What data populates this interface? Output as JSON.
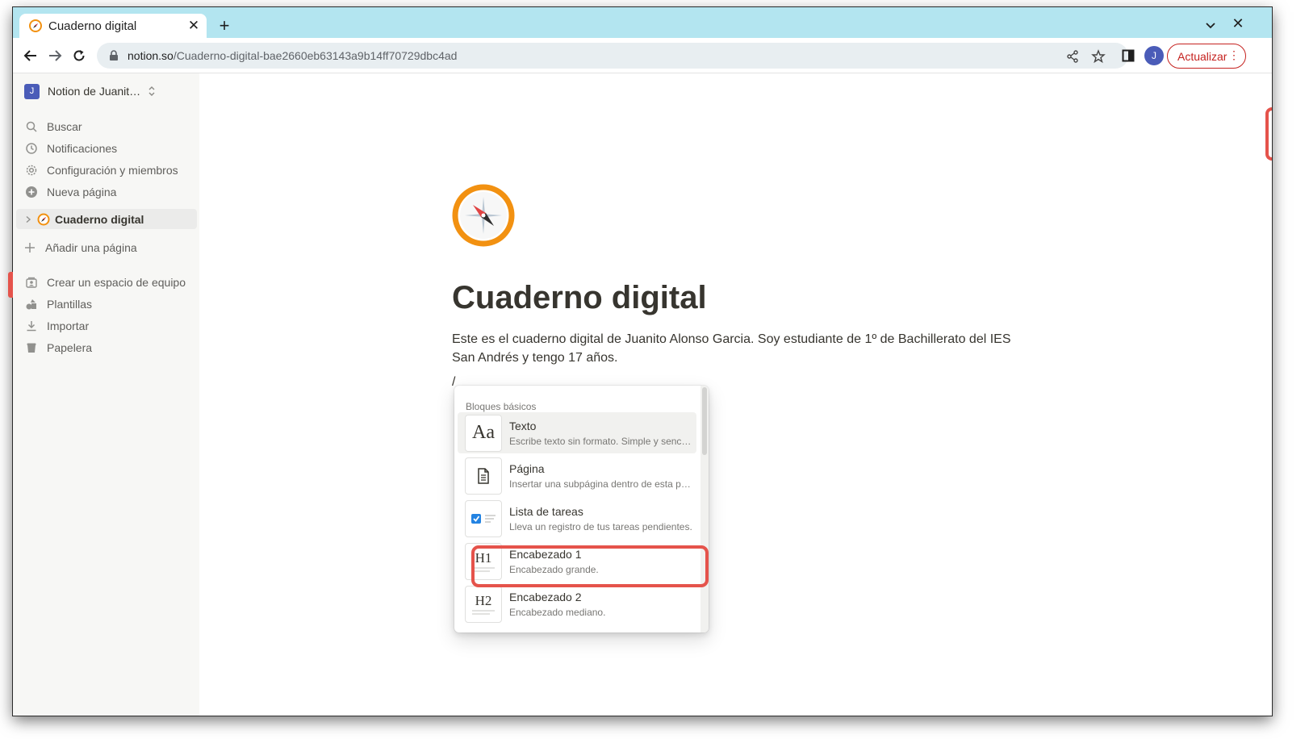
{
  "browser": {
    "tab_title": "Cuaderno digital",
    "url_domain": "notion.so",
    "url_path": "/Cuaderno-digital-bae2660eb63143a9b14ff70729dbc4ad",
    "profile_initial": "J",
    "update_label": "Actualizar"
  },
  "sidebar": {
    "workspace_initial": "J",
    "workspace_name": "Notion de Juanit…",
    "top_items": [
      {
        "label": "Buscar",
        "icon": "search-icon"
      },
      {
        "label": "Notificaciones",
        "icon": "clock-icon"
      },
      {
        "label": "Configuración y miembros",
        "icon": "gear-icon"
      },
      {
        "label": "Nueva página",
        "icon": "plus-circle-icon"
      }
    ],
    "page": "Cuaderno digital",
    "add_page": "Añadir una página",
    "bottom_items": [
      {
        "label": "Crear un espacio de equipo",
        "icon": "teamspace-icon"
      },
      {
        "label": "Plantillas",
        "icon": "templates-icon"
      },
      {
        "label": "Importar",
        "icon": "import-icon"
      },
      {
        "label": "Papelera",
        "icon": "trash-icon"
      }
    ]
  },
  "page": {
    "icon": "compass-icon",
    "title": "Cuaderno digital",
    "description": "Este es el cuaderno digital de Juanito Alonso Garcia. Soy estudiante de 1º de Bachillerato del IES San Andrés y tengo 17 años.",
    "typed": "/"
  },
  "slash_menu": {
    "header": "Bloques básicos",
    "items": [
      {
        "label": "Texto",
        "desc": "Escribe texto sin formato. Simple y senc…",
        "thumb": "Aa",
        "active": true
      },
      {
        "label": "Página",
        "desc": "Insertar una subpágina dentro de esta p…",
        "thumb": "page-icon"
      },
      {
        "label": "Lista de tareas",
        "desc": "Lleva un registro de tus tareas pendientes.",
        "thumb": "checkbox-icon"
      },
      {
        "label": "Encabezado 1",
        "desc": "Encabezado grande.",
        "thumb": "H1",
        "highlighted": true
      },
      {
        "label": "Encabezado 2",
        "desc": "Encabezado mediano.",
        "thumb": "H2"
      }
    ]
  },
  "colors": {
    "tabstrip": "#b3e5f0",
    "sidebar_bg": "#f7f7f5",
    "highlight": "#e5534b",
    "update_red": "#c5221f"
  }
}
